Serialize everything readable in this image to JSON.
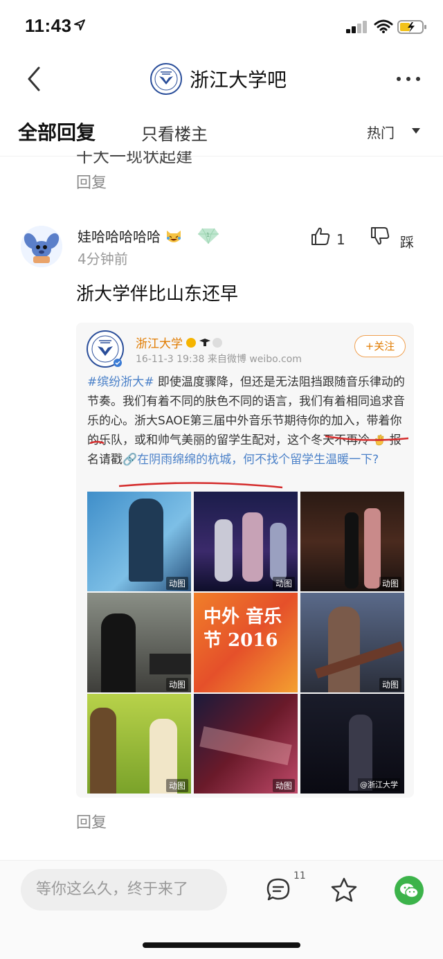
{
  "status": {
    "time": "11:43"
  },
  "nav": {
    "title": "浙江大学吧"
  },
  "tabs": {
    "all": "全部回复",
    "owner_only": "只看楼主",
    "sort": "热门"
  },
  "prev_reply": {
    "cut_text": "干大一现状起建",
    "reply_label": "回复"
  },
  "post": {
    "username": "娃哈哈哈哈哈",
    "time_ago": "4分钟前",
    "like_count": "1",
    "dislike_label": "踩",
    "content": "浙大学伴比山东还早",
    "reply_label": "回复"
  },
  "weibo": {
    "account": "浙江大学",
    "meta": "16-11-3 19:38  来自微博 weibo.com",
    "follow": "+关注",
    "hashtag": "#缤纷浙大#",
    "body1": " 即使温度骤降，但还是无法阻挡跟随音乐律动的节奏。我们有着不同的肤色不同的语言，我们有着相同追求音乐的心。浙大SAOE第三届中外音乐节期待你的加入，带着你的乐队，或和帅气美丽的留学生配对，这个冬天不再冷",
    "body2": " 报名请戳",
    "link": "🔗在阴雨绵绵的杭城，何不找个留学生温暖一下?",
    "gif_label": "动图",
    "poster_text": "中外 音乐节 2016",
    "watermark": "@浙江大学"
  },
  "bottom": {
    "input_placeholder": "等你这么久，终于来了",
    "comment_badge": "11"
  },
  "colors": {
    "accent": "#4a80c8",
    "weibo_orange": "#e07b00",
    "wechat_green": "#3cb34a"
  }
}
